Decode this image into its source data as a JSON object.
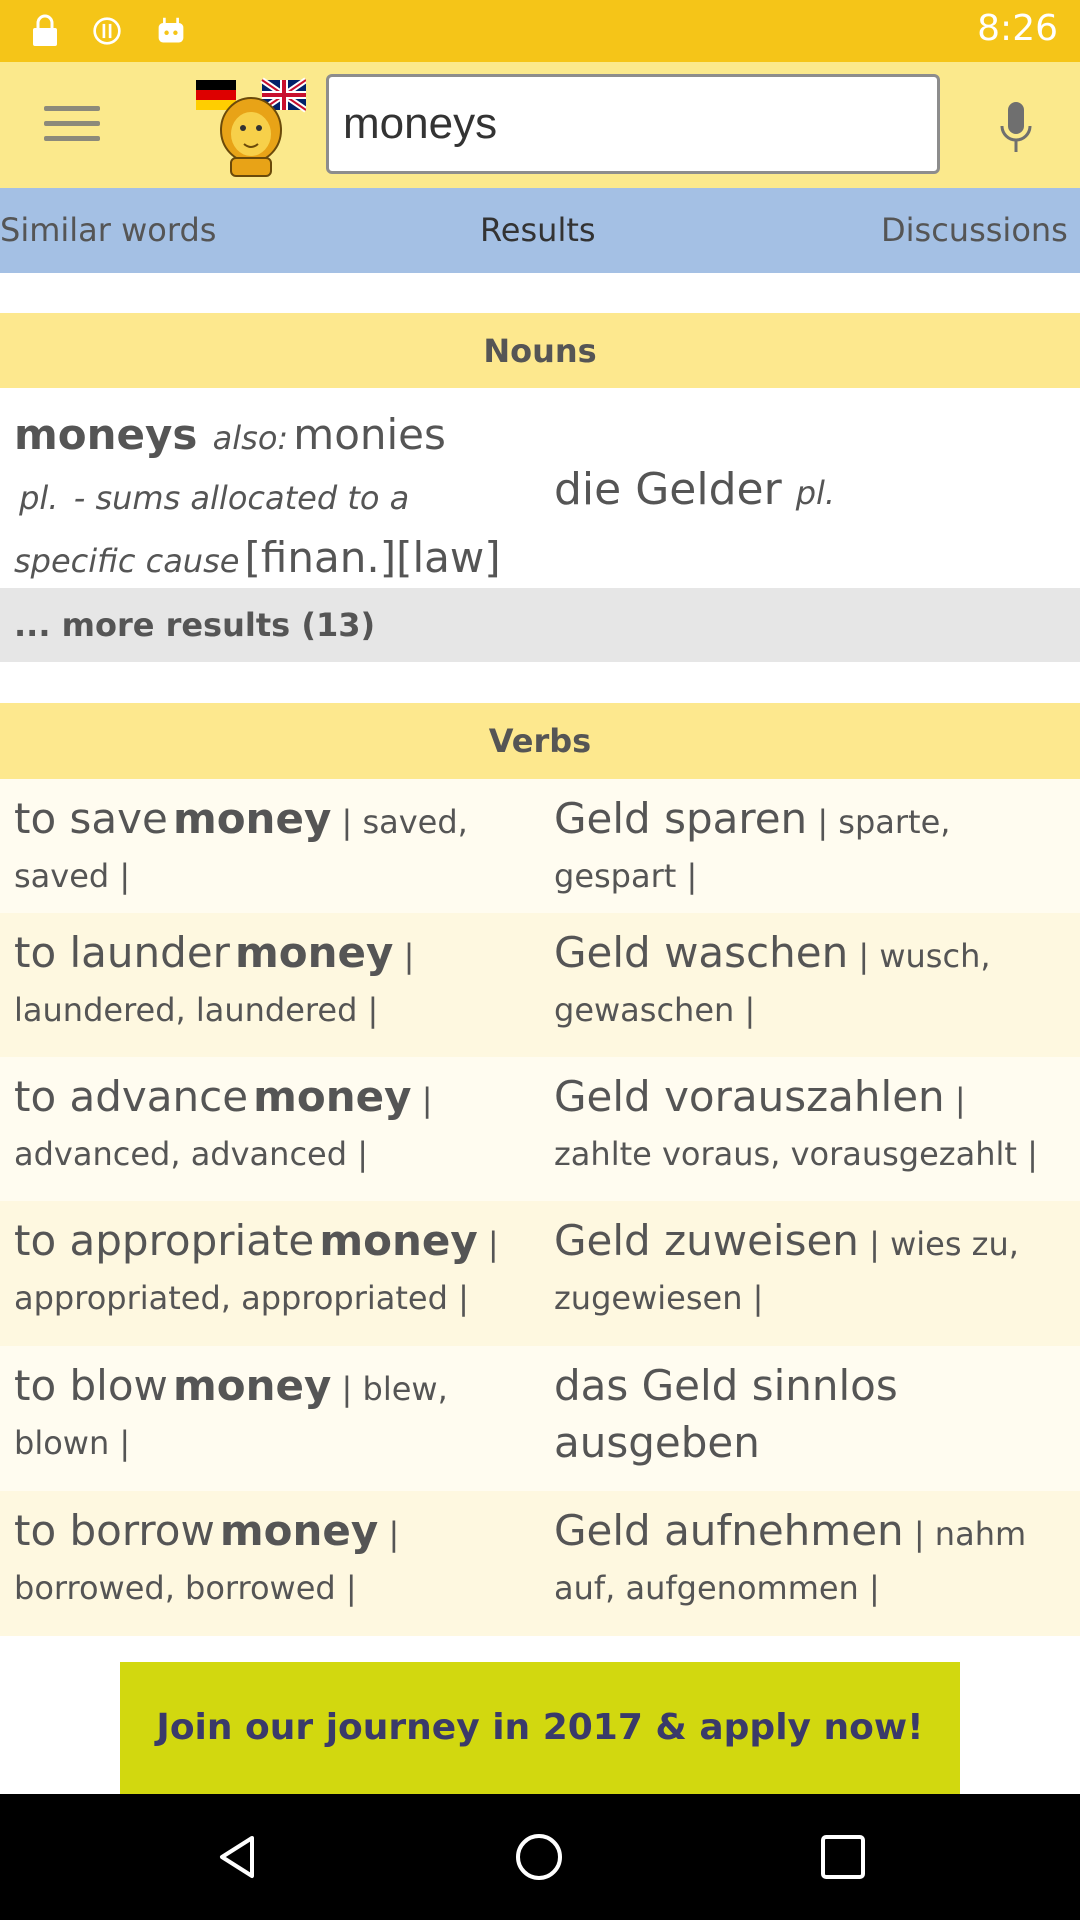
{
  "status_bar": {
    "time": "8:26",
    "icons": [
      "lock-icon",
      "alert-icon",
      "android-icon"
    ]
  },
  "app_bar": {
    "menu_icon": "hamburger-menu-icon",
    "logo": "leo-lion-logo",
    "search_value": "moneys",
    "mic_icon": "microphone-icon"
  },
  "tabs": [
    {
      "label": "Similar words"
    },
    {
      "label": "Results"
    },
    {
      "label": "Discussions"
    }
  ],
  "nouns": {
    "header": "Nouns",
    "entry": {
      "term": "moneys",
      "also_label": "also:",
      "also_term": "monies",
      "pl_label": "pl.",
      "definition": "- sums allocated to a specific cause",
      "tags": "[finan.][law]",
      "translation": "die Gelder",
      "translation_pl": "pl."
    },
    "more_results": "... more results (13)"
  },
  "verbs": {
    "header": "Verbs",
    "rows": [
      {
        "en_pre": "to save",
        "en_bold": "money",
        "en_forms": "| saved, saved |",
        "de_main": "Geld sparen",
        "de_forms": "| sparte, gespart |"
      },
      {
        "en_pre": "to launder",
        "en_bold": "money",
        "en_forms": "| laundered, laundered |",
        "de_main": "Geld waschen",
        "de_forms": "| wusch, gewaschen |"
      },
      {
        "en_pre": "to advance",
        "en_bold": "money",
        "en_forms": "| advanced, advanced |",
        "de_main": "Geld vorauszahlen",
        "de_forms": "| zahlte voraus, vorausgezahlt |"
      },
      {
        "en_pre": "to appropriate",
        "en_bold": "money",
        "en_forms": "| appropriated, appropriated |",
        "de_main": "Geld zuweisen",
        "de_forms": "| wies zu, zugewiesen |"
      },
      {
        "en_pre": "to blow",
        "en_bold": "money",
        "en_forms": "| blew, blown |",
        "de_main": "das Geld sinnlos ausgeben",
        "de_forms": ""
      },
      {
        "en_pre": "to borrow",
        "en_bold": "money",
        "en_forms": "| borrowed, borrowed |",
        "de_main": "Geld aufnehmen",
        "de_forms": "| nahm auf, aufgenommen |"
      }
    ]
  },
  "banner": {
    "text": "Join our journey in 2017 & apply now!"
  },
  "nav_bar": {
    "icons": [
      "back-icon",
      "home-icon",
      "recents-icon"
    ]
  },
  "colors": {
    "status": "#f5c518",
    "appbar": "#fbe98c",
    "tabs": "#a4c0e4",
    "section": "#fde88e",
    "banner": "#d2d80f"
  }
}
